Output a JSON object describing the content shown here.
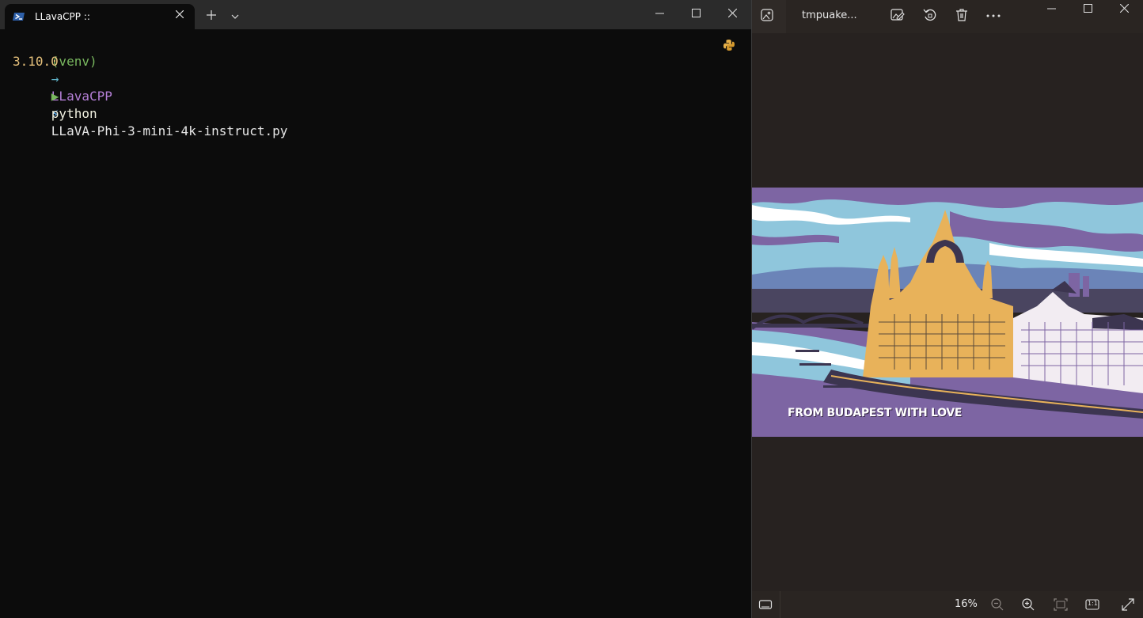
{
  "terminal": {
    "tab_title": "LLavaCPP ::",
    "prompt": {
      "venv": "(venv)",
      "arrow": "→",
      "dir": "LLavaCPP",
      "bolt": "⚡"
    },
    "python_version": "3.10.0",
    "command_marker": "▶",
    "command_name": "python",
    "command_args": "LLaVA-Phi-3-mini-4k-instruct.py",
    "new_tab_label": "+",
    "dropdown_label": "⌄"
  },
  "photos": {
    "file_title": "tmpuake...",
    "caption": "FROM BUDAPEST WITH LOVE",
    "zoom": "16%",
    "actual_size_label": "1:1"
  },
  "colors": {
    "terminal_bg": "#0c0c0c",
    "titlebar_bg": "#2b2b2b",
    "photos_bg": "#272220",
    "venv_green": "#79b85f",
    "dir_purple": "#b47fd6",
    "version_yellow": "#e5c07b"
  },
  "icons": [
    "powershell-icon",
    "close-icon",
    "plus-icon",
    "chevron-down-icon",
    "minimize-icon",
    "maximize-icon",
    "python-icon",
    "gallery-icon",
    "edit-image-icon",
    "rotate-icon",
    "delete-icon",
    "more-icon",
    "filmstrip-icon",
    "zoom-out-icon",
    "zoom-in-icon",
    "fit-icon",
    "fullscreen-icon"
  ]
}
